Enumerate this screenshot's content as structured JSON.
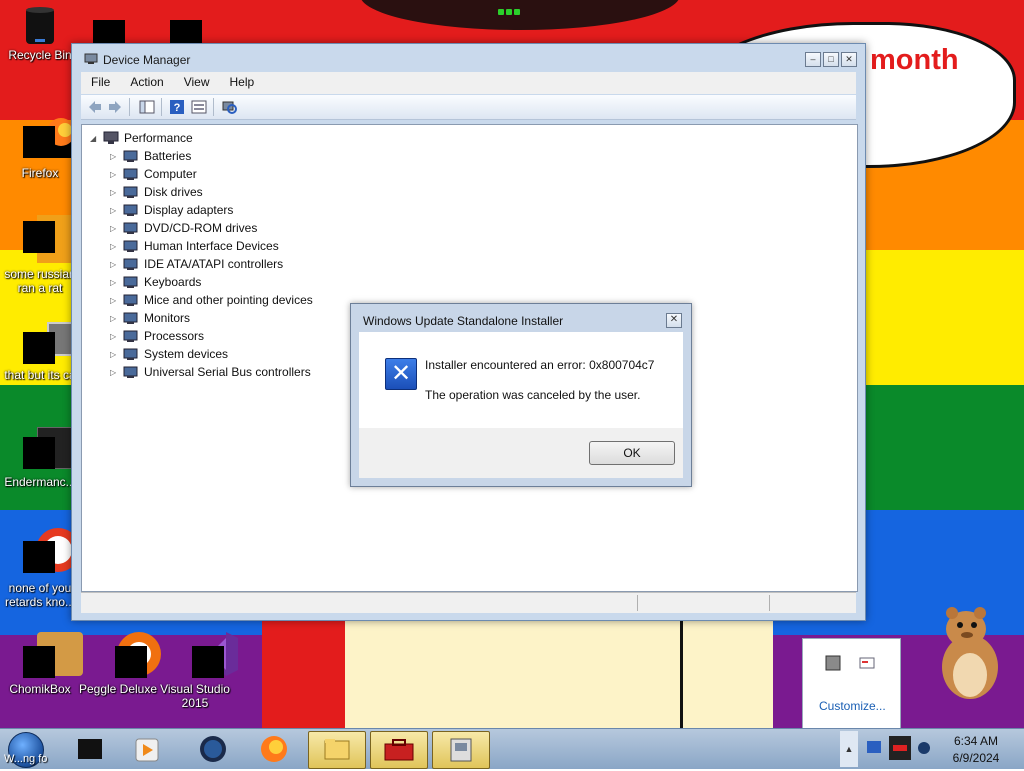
{
  "wallpaper": {
    "caption": "month",
    "stripe_colors": [
      "#e31c1c",
      "#ff8a00",
      "#ffec00",
      "#0a8a2a",
      "#1565e0",
      "#7a1a90"
    ]
  },
  "desktop_icons": [
    {
      "label": "Recycle Bin",
      "icon": "recycle-bin-icon"
    },
    {
      "label": "Firefox",
      "icon": "firefox-icon"
    },
    {
      "label": "some russian ran a rat",
      "icon": "app-icon"
    },
    {
      "label": "that but its ca",
      "icon": "app-icon"
    },
    {
      "label": "Endermanc...",
      "icon": "app-icon"
    },
    {
      "label": "none of you retards kno...",
      "icon": "app-icon"
    },
    {
      "label": "ChomikBox",
      "icon": "chomikbox-icon"
    },
    {
      "label": "Peggle Deluxe",
      "icon": "peggle-icon"
    },
    {
      "label": "Visual Studio 2015",
      "icon": "visual-studio-icon"
    }
  ],
  "device_manager": {
    "title": "Device Manager",
    "menu": [
      "File",
      "Action",
      "View",
      "Help"
    ],
    "root": "Performance",
    "devices": [
      "Batteries",
      "Computer",
      "Disk drives",
      "Display adapters",
      "DVD/CD-ROM drives",
      "Human Interface Devices",
      "IDE ATA/ATAPI controllers",
      "Keyboards",
      "Mice and other pointing devices",
      "Monitors",
      "Processors",
      "System devices",
      "Universal Serial Bus controllers"
    ]
  },
  "dialog": {
    "title": "Windows Update Standalone Installer",
    "message_line1": "Installer encountered an error: 0x800704c7",
    "message_line2": "The operation was canceled by the user.",
    "ok_label": "OK"
  },
  "taskbar": {
    "start_label": "W...ng fo",
    "time": "6:34 AM",
    "date": "6/9/2024",
    "customize_label": "Customize...",
    "accent": "#8aa6c6"
  }
}
